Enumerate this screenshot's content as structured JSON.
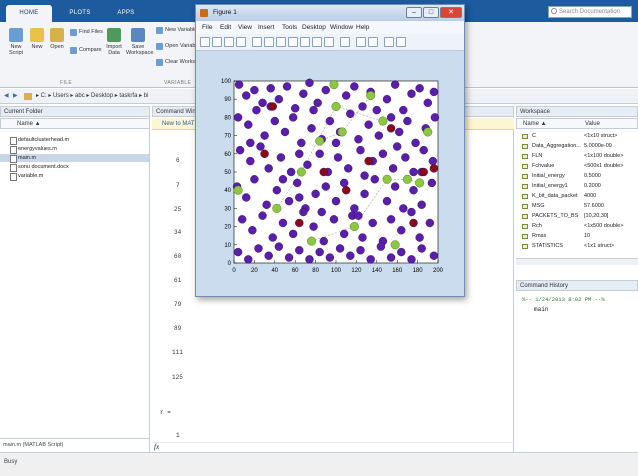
{
  "ribbon": {
    "tabs": [
      "HOME",
      "PLOTS",
      "APPS"
    ],
    "search_placeholder": "Search Documentation",
    "buttons": {
      "new_script": "New\nScript",
      "new": "New",
      "open": "Open",
      "find_files": "Find Files",
      "compare": "Compare",
      "import_data": "Import\nData",
      "save_workspace": "Save\nWorkspace",
      "new_variable": "New Variable",
      "open_variable": "Open Variable",
      "clear_workspace": "Clear Workspace"
    },
    "groups": {
      "file": "FILE",
      "variable": "VARIABLE"
    }
  },
  "address": {
    "path": "▸ C: ▸ Users ▸ abc ▸ Desktop ▸ taskrfa ▸ bi"
  },
  "current_folder": {
    "title": "Current Folder",
    "column": "Name ▲",
    "files": [
      "defaultclusterhead.m",
      "energyvalues.m",
      "main.m",
      "sonu document.docx",
      "variable.m"
    ],
    "selected": "main.m",
    "footer": "main.m (MATLAB Script)"
  },
  "command_window": {
    "title": "Command Window",
    "notice": "New to MATLAB?",
    "numbers": [
      "6",
      "7",
      "25",
      "34",
      "60",
      "61",
      "79",
      "89",
      "111",
      "125"
    ],
    "prompt_var": "r =",
    "prompt_val": "1",
    "fx": "fx"
  },
  "workspace": {
    "title": "Workspace",
    "col_name": "Name ▲",
    "col_value": "Value",
    "rows": [
      {
        "name": "C",
        "value": "<1x10 struct>"
      },
      {
        "name": "Data_Aggregation...",
        "value": "5.0000e-09"
      },
      {
        "name": "FLN",
        "value": "<1x100 double>"
      },
      {
        "name": "Fchvalue",
        "value": "<500x1 double>"
      },
      {
        "name": "Initial_energy",
        "value": "0.5000"
      },
      {
        "name": "Initial_energy1",
        "value": "0.2000"
      },
      {
        "name": "K_bit_data_packet",
        "value": "4000"
      },
      {
        "name": "MSG",
        "value": "57.6000"
      },
      {
        "name": "PACKETS_TO_BS",
        "value": "[10,20,30]"
      },
      {
        "name": "Rch",
        "value": "<1x500 double>"
      },
      {
        "name": "Rmax",
        "value": "10"
      },
      {
        "name": "STATISTICS",
        "value": "<1x1 struct>"
      }
    ]
  },
  "history": {
    "title": "Command History",
    "entry_header": "%-- 1/24/2013 8:02 PM --%",
    "entry": "main"
  },
  "status": {
    "text": "Busy"
  },
  "figure": {
    "title": "Figure 1",
    "menu": [
      "File",
      "Edit",
      "View",
      "Insert",
      "Tools",
      "Desktop",
      "Window",
      "Help"
    ],
    "close_glyph": "✕"
  },
  "chart_data": {
    "type": "scatter",
    "title": "",
    "xlabel": "",
    "ylabel": "",
    "xlim": [
      0,
      200
    ],
    "ylim": [
      0,
      100
    ],
    "xticks": [
      0,
      20,
      40,
      60,
      80,
      100,
      120,
      140,
      160,
      180,
      200
    ],
    "yticks": [
      0,
      10,
      20,
      30,
      40,
      50,
      60,
      70,
      80,
      90,
      100
    ],
    "grid": false,
    "colors": {
      "nodes": "#5a1fa8",
      "cluster_heads": "#8dc63f",
      "dead": "#8b0a1a",
      "links": "#9aa88a"
    },
    "series": [
      {
        "values": [
          [
            5,
            98
          ],
          [
            12,
            92
          ],
          [
            20,
            95
          ],
          [
            28,
            88
          ],
          [
            36,
            96
          ],
          [
            44,
            90
          ],
          [
            52,
            97
          ],
          [
            60,
            85
          ],
          [
            68,
            93
          ],
          [
            74,
            99
          ],
          [
            82,
            88
          ],
          [
            90,
            95
          ],
          [
            110,
            92
          ],
          [
            118,
            97
          ],
          [
            126,
            86
          ],
          [
            134,
            94
          ],
          [
            150,
            90
          ],
          [
            158,
            98
          ],
          [
            166,
            84
          ],
          [
            174,
            93
          ],
          [
            182,
            96
          ],
          [
            190,
            88
          ],
          [
            196,
            94
          ],
          [
            4,
            80
          ],
          [
            14,
            76
          ],
          [
            22,
            84
          ],
          [
            30,
            70
          ],
          [
            40,
            78
          ],
          [
            50,
            72
          ],
          [
            58,
            80
          ],
          [
            66,
            66
          ],
          [
            76,
            74
          ],
          [
            86,
            68
          ],
          [
            94,
            78
          ],
          [
            104,
            72
          ],
          [
            114,
            82
          ],
          [
            122,
            68
          ],
          [
            132,
            76
          ],
          [
            142,
            70
          ],
          [
            154,
            80
          ],
          [
            162,
            72
          ],
          [
            170,
            78
          ],
          [
            178,
            66
          ],
          [
            188,
            74
          ],
          [
            197,
            80
          ],
          [
            6,
            62
          ],
          [
            16,
            56
          ],
          [
            26,
            64
          ],
          [
            34,
            52
          ],
          [
            46,
            58
          ],
          [
            56,
            50
          ],
          [
            64,
            60
          ],
          [
            72,
            54
          ],
          [
            84,
            60
          ],
          [
            92,
            50
          ],
          [
            102,
            58
          ],
          [
            112,
            52
          ],
          [
            124,
            62
          ],
          [
            136,
            56
          ],
          [
            146,
            60
          ],
          [
            156,
            52
          ],
          [
            168,
            58
          ],
          [
            176,
            50
          ],
          [
            186,
            62
          ],
          [
            195,
            56
          ],
          [
            3,
            42
          ],
          [
            12,
            36
          ],
          [
            20,
            46
          ],
          [
            32,
            32
          ],
          [
            42,
            40
          ],
          [
            54,
            34
          ],
          [
            62,
            44
          ],
          [
            70,
            30
          ],
          [
            80,
            38
          ],
          [
            90,
            42
          ],
          [
            100,
            34
          ],
          [
            108,
            44
          ],
          [
            118,
            30
          ],
          [
            128,
            38
          ],
          [
            138,
            46
          ],
          [
            150,
            34
          ],
          [
            158,
            42
          ],
          [
            166,
            30
          ],
          [
            176,
            40
          ],
          [
            184,
            32
          ],
          [
            194,
            44
          ],
          [
            8,
            24
          ],
          [
            18,
            18
          ],
          [
            28,
            26
          ],
          [
            38,
            14
          ],
          [
            48,
            22
          ],
          [
            58,
            16
          ],
          [
            68,
            28
          ],
          [
            78,
            20
          ],
          [
            88,
            12
          ],
          [
            98,
            24
          ],
          [
            108,
            16
          ],
          [
            116,
            26
          ],
          [
            126,
            14
          ],
          [
            136,
            22
          ],
          [
            146,
            12
          ],
          [
            154,
            24
          ],
          [
            164,
            18
          ],
          [
            174,
            28
          ],
          [
            182,
            14
          ],
          [
            192,
            22
          ],
          [
            4,
            6
          ],
          [
            14,
            2
          ],
          [
            24,
            8
          ],
          [
            34,
            4
          ],
          [
            44,
            9
          ],
          [
            54,
            3
          ],
          [
            64,
            7
          ],
          [
            74,
            2
          ],
          [
            84,
            6
          ],
          [
            94,
            3
          ],
          [
            104,
            8
          ],
          [
            114,
            4
          ],
          [
            124,
            7
          ],
          [
            134,
            2
          ],
          [
            144,
            9
          ],
          [
            154,
            3
          ],
          [
            164,
            6
          ],
          [
            174,
            2
          ],
          [
            184,
            8
          ],
          [
            196,
            4
          ],
          [
            16,
            66
          ],
          [
            36,
            86
          ],
          [
            78,
            84
          ],
          [
            100,
            66
          ],
          [
            128,
            48
          ],
          [
            140,
            84
          ],
          [
            160,
            64
          ],
          [
            184,
            50
          ],
          [
            48,
            46
          ],
          [
            86,
            28
          ],
          [
            122,
            26
          ],
          [
            64,
            36
          ]
        ],
        "color": "#5a1fa8"
      },
      {
        "values": [
          [
            4,
            40
          ],
          [
            42,
            30
          ],
          [
            66,
            50
          ],
          [
            76,
            12
          ],
          [
            84,
            67
          ],
          [
            98,
            98
          ],
          [
            100,
            86
          ],
          [
            106,
            72
          ],
          [
            118,
            20
          ],
          [
            134,
            92
          ],
          [
            146,
            78
          ],
          [
            150,
            46
          ],
          [
            158,
            10
          ],
          [
            170,
            46
          ],
          [
            182,
            44
          ],
          [
            190,
            72
          ]
        ],
        "color": "#8dc63f"
      },
      {
        "values": [
          [
            38,
            86
          ],
          [
            30,
            60
          ],
          [
            64,
            22
          ],
          [
            88,
            50
          ],
          [
            132,
            56
          ],
          [
            154,
            74
          ],
          [
            176,
            22
          ],
          [
            186,
            50
          ],
          [
            196,
            52
          ],
          [
            110,
            40
          ]
        ],
        "color": "#8b0a1a"
      }
    ],
    "links": [
      [
        [
          66,
          50
        ],
        [
          100,
          86
        ]
      ],
      [
        [
          100,
          86
        ],
        [
          146,
          78
        ]
      ],
      [
        [
          66,
          50
        ],
        [
          42,
          30
        ]
      ],
      [
        [
          150,
          46
        ],
        [
          170,
          46
        ]
      ],
      [
        [
          170,
          46
        ],
        [
          182,
          44
        ]
      ],
      [
        [
          118,
          20
        ],
        [
          150,
          46
        ]
      ],
      [
        [
          76,
          12
        ],
        [
          118,
          20
        ]
      ],
      [
        [
          84,
          67
        ],
        [
          106,
          72
        ]
      ],
      [
        [
          106,
          72
        ],
        [
          134,
          92
        ]
      ]
    ]
  }
}
